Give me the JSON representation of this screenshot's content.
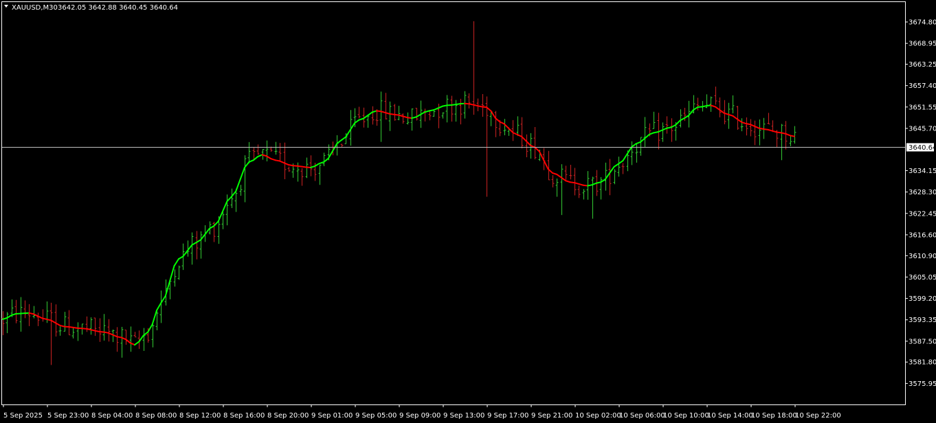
{
  "header": {
    "symbol": "XAUUSD,M30",
    "ohlc": "3642.05 3642.88 3640.45 3640.64"
  },
  "colors": {
    "background": "#000000",
    "frame": "#ffffff",
    "bull_bar": "#33cc33",
    "bear_bar": "#cc2222",
    "ma_up": "#00ff00",
    "ma_down": "#ff0000",
    "price_line": "#c0c0c0",
    "price_label_bg": "#ffffff"
  },
  "current_price_label": "3640.64",
  "y_tick_labels": [
    "3674.80",
    "3668.95",
    "3663.25",
    "3657.40",
    "3651.55",
    "3645.70",
    "3634.15",
    "3628.30",
    "3622.45",
    "3616.60",
    "3610.90",
    "3605.05",
    "3599.20",
    "3593.35",
    "3587.50",
    "3581.80",
    "3575.95"
  ],
  "x_tick_labels": [
    "5 Sep 2025",
    "5 Sep 23:00",
    "8 Sep 04:00",
    "8 Sep 08:00",
    "8 Sep 12:00",
    "8 Sep 16:00",
    "8 Sep 20:00",
    "9 Sep 01:00",
    "9 Sep 05:00",
    "9 Sep 09:00",
    "9 Sep 13:00",
    "9 Sep 17:00",
    "9 Sep 21:00",
    "10 Sep 02:00",
    "10 Sep 06:00",
    "10 Sep 10:00",
    "10 Sep 14:00",
    "10 Sep 18:00",
    "10 Sep 22:00"
  ],
  "chart_data": {
    "type": "line",
    "ylim": [
      3575.95,
      3680.0
    ],
    "current_price": 3640.64,
    "bar_count": 181,
    "ma_anchors": [
      [
        0,
        3593.5
      ],
      [
        3,
        3595.0
      ],
      [
        6,
        3595.2
      ],
      [
        10,
        3593.5
      ],
      [
        14,
        3591.5
      ],
      [
        18,
        3591.0
      ],
      [
        23,
        3590.0
      ],
      [
        27,
        3588.5
      ],
      [
        30,
        3586.5
      ],
      [
        33,
        3590.0
      ],
      [
        36,
        3598.0
      ],
      [
        40,
        3610.0
      ],
      [
        44,
        3614.5
      ],
      [
        48,
        3619.0
      ],
      [
        52,
        3627.0
      ],
      [
        56,
        3636.5
      ],
      [
        59,
        3638.5
      ],
      [
        62,
        3637.0
      ],
      [
        66,
        3635.5
      ],
      [
        70,
        3635.0
      ],
      [
        73,
        3636.5
      ],
      [
        77,
        3642.5
      ],
      [
        81,
        3648.0
      ],
      [
        85,
        3650.5
      ],
      [
        89,
        3649.5
      ],
      [
        93,
        3648.5
      ],
      [
        97,
        3650.5
      ],
      [
        101,
        3652.0
      ],
      [
        105,
        3652.5
      ],
      [
        110,
        3651.5
      ],
      [
        113,
        3647.5
      ],
      [
        117,
        3644.0
      ],
      [
        121,
        3640.5
      ],
      [
        125,
        3633.5
      ],
      [
        129,
        3631.0
      ],
      [
        133,
        3630.0
      ],
      [
        136,
        3631.0
      ],
      [
        140,
        3636.0
      ],
      [
        144,
        3641.5
      ],
      [
        148,
        3644.5
      ],
      [
        152,
        3646.0
      ],
      [
        155,
        3648.5
      ],
      [
        158,
        3651.5
      ],
      [
        161,
        3652.0
      ],
      [
        165,
        3649.5
      ],
      [
        169,
        3647.0
      ],
      [
        173,
        3645.5
      ],
      [
        177,
        3644.5
      ],
      [
        180,
        3643.5
      ]
    ],
    "shock_bars": [
      [
        11,
        3581.0
      ],
      [
        27,
        3583.0
      ],
      [
        86,
        3642.0
      ],
      [
        107,
        3675.0
      ],
      [
        110,
        3627.0
      ],
      [
        127,
        3622.0
      ],
      [
        134,
        3621.0
      ],
      [
        177,
        3637.0
      ]
    ]
  }
}
